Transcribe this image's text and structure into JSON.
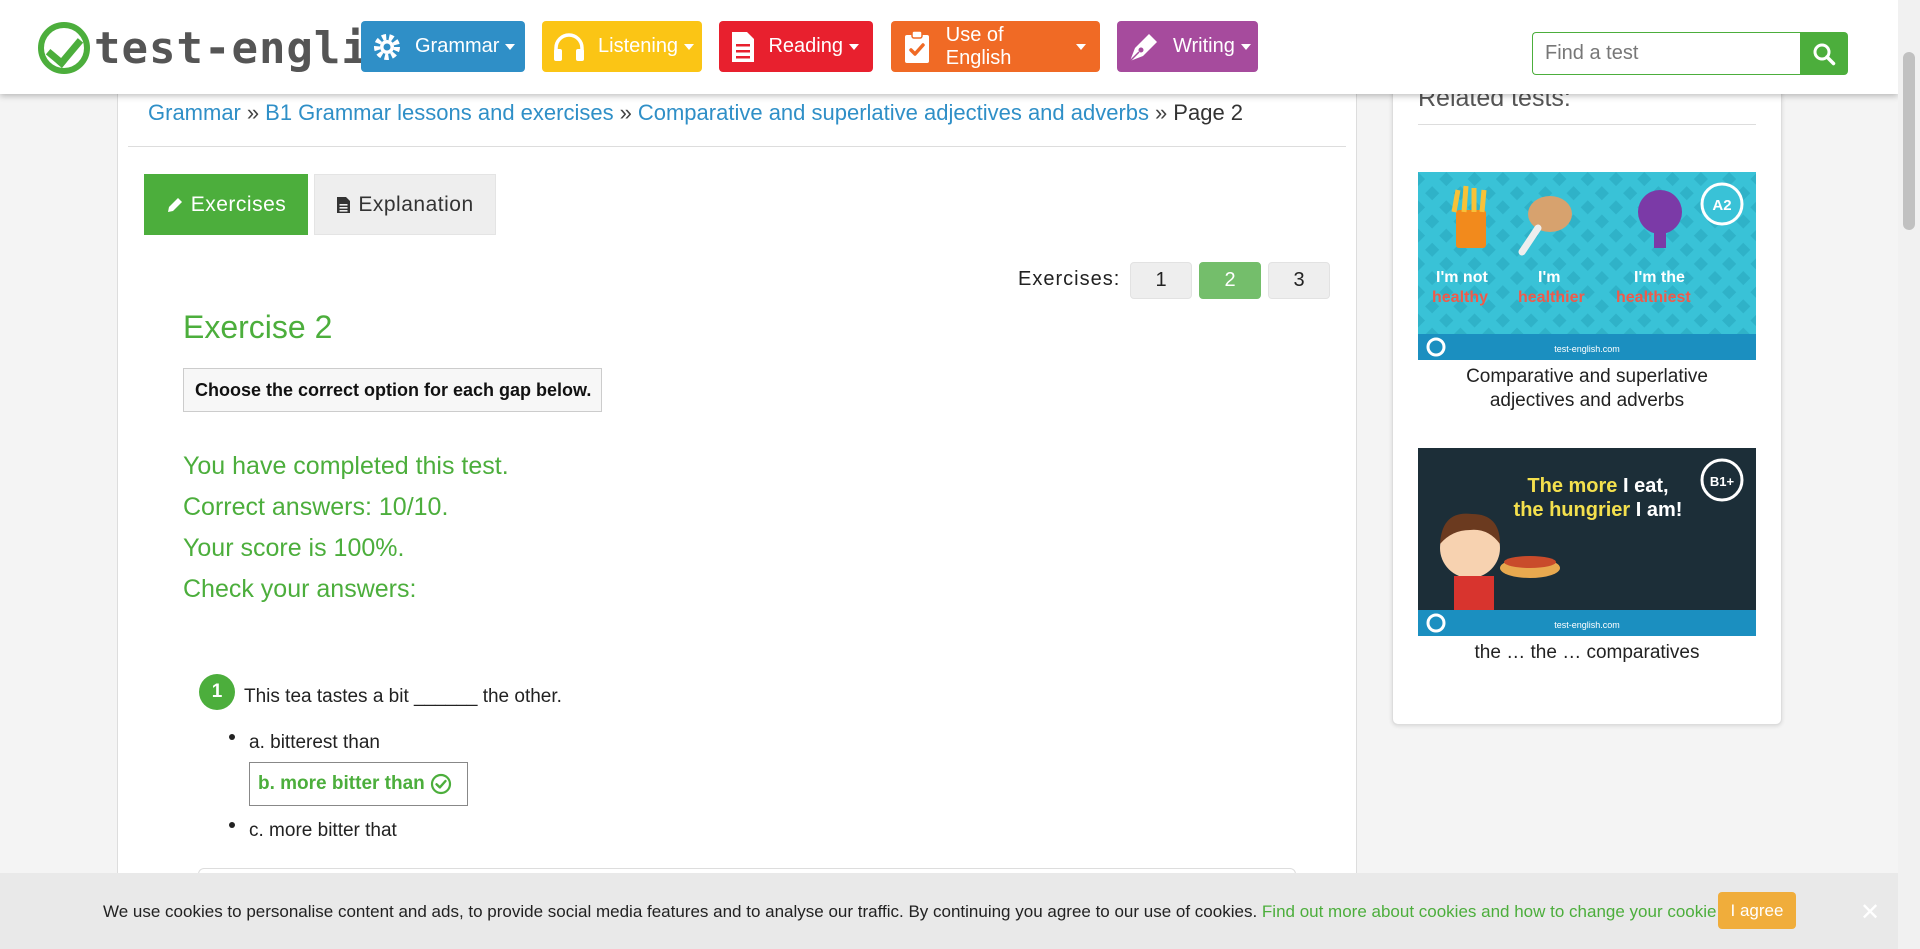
{
  "colors": {
    "brand_green": "#4cae3c",
    "grammar": "#2f8fc7",
    "listening": "#fbc515",
    "reading": "#e8202e",
    "use_of_english": "#f06a25",
    "writing": "#a64b9d",
    "cookie_button": "#f0ad3b"
  },
  "logo": {
    "text": "test-english"
  },
  "nav": [
    {
      "label": "Grammar",
      "icon": "gear-icon"
    },
    {
      "label": "Listening",
      "icon": "headphones-icon"
    },
    {
      "label": "Reading",
      "icon": "document-icon"
    },
    {
      "label": "Use of English",
      "icon": "clipboard-check-icon"
    },
    {
      "label": "Writing",
      "icon": "pen-icon"
    }
  ],
  "search": {
    "placeholder": "Find a test"
  },
  "breadcrumb": {
    "items": [
      "Grammar",
      "B1 Grammar lessons and exercises",
      "Comparative and superlative adjectives and adverbs"
    ],
    "separator": "»",
    "current": "Page 2"
  },
  "tabs": {
    "exercises": "Exercises",
    "explanation": "Explanation"
  },
  "pagination": {
    "label": "Exercises:",
    "pages": [
      "1",
      "2",
      "3"
    ],
    "active": "2"
  },
  "exercise": {
    "title": "Exercise 2",
    "instruction": "Choose the correct option for each gap below.",
    "results": [
      "You have completed this test.",
      "Correct answers: 10/10.",
      "Your score is 100%.",
      "Check your answers:"
    ],
    "question": {
      "number": "1",
      "text": "This tea tastes a bit ______ the other.",
      "options": [
        "a. bitterest than",
        "b. more bitter than",
        "c. more bitter that"
      ],
      "correct_option": "b. more bitter than"
    }
  },
  "sidebar": {
    "heading": "Related tests:",
    "tests": [
      {
        "caption_line1": "Comparative and superlative",
        "caption_line2": "adjectives and adverbs",
        "badge": "A2",
        "image_words": [
          "I'm not",
          "I'm",
          "I'm the",
          "healthy",
          "healthier",
          "healthiest"
        ],
        "watermark": "test-english.com"
      },
      {
        "caption_line1": "the … the … comparatives",
        "badge": "B1+",
        "image_line1_a": "The more",
        "image_line1_b": " I eat,",
        "image_line2_a": "the hungrier",
        "image_line2_b": " I am!",
        "watermark": "test-english.com"
      }
    ]
  },
  "cookie": {
    "text": "We use cookies to personalise content and ads, to provide social media features and to analyse our traffic. By continuing you agree to our use of cookies.",
    "link": "Find out more about cookies and how to change your cookie settings",
    "button": "I agree"
  }
}
